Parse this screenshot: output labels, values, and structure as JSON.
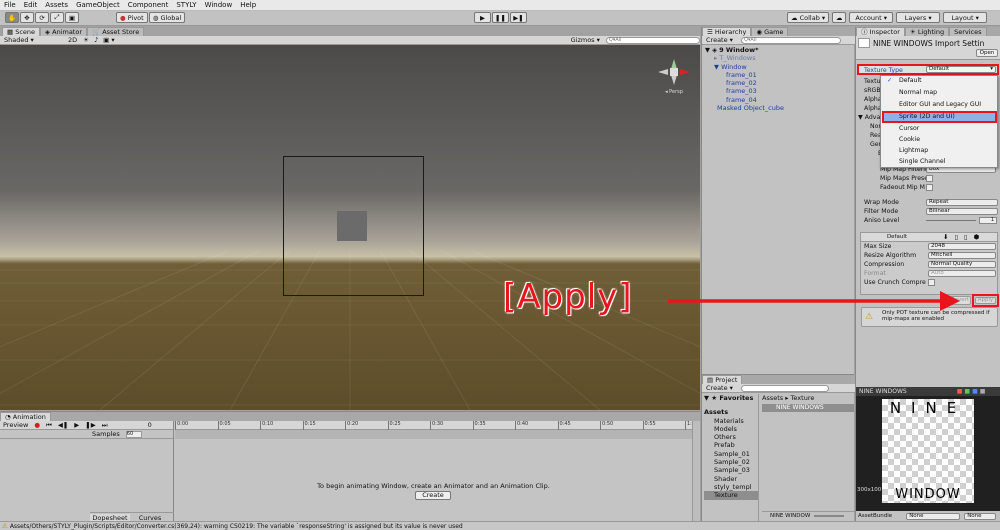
{
  "menu": [
    "File",
    "Edit",
    "Assets",
    "GameObject",
    "Component",
    "STYLY",
    "Window",
    "Help"
  ],
  "toolbar": {
    "pivot": "Pivot",
    "global": "Global",
    "collab": "Collab",
    "account": "Account",
    "layers": "Layers",
    "layout": "Layout"
  },
  "scene": {
    "tabs": [
      "Scene",
      "Animator",
      "Asset Store"
    ],
    "shading": "Shaded",
    "mode_2d": "2D",
    "gizmos": "Gizmos",
    "search": "Q▾All",
    "persp": "◂ Persp"
  },
  "annotation": {
    "label": "[Apply]",
    "color": "#e8151c"
  },
  "hierarchy": {
    "tabs": [
      "Hierarchy",
      "Game"
    ],
    "create": "Create",
    "search": "Q▾All",
    "items": [
      "9 Window*",
      "T_Windows",
      "Window",
      "frame_01",
      "frame_02",
      "frame_03",
      "frame_04",
      "Masked Object_cube"
    ]
  },
  "project": {
    "tab": "Project",
    "create": "Create",
    "favorites": "Favorites",
    "breadcrumb": "Assets ▸ Texture",
    "asset": "NINE WINDOWS",
    "tree": [
      "Assets",
      "Materials",
      "Models",
      "Others",
      "Prefab",
      "Sample_01",
      "Sample_02",
      "Sample_03",
      "Shader",
      "styly_templ",
      "Texture"
    ],
    "footer": "NINE WINDOW"
  },
  "inspector": {
    "tabs": [
      "Inspector",
      "Lighting",
      "Services"
    ],
    "title": "NINE WINDOWS Import Settin",
    "open": "Open",
    "texture_type_label": "Texture Type",
    "texture_type_value": "Default",
    "options": [
      "Default",
      "Normal map",
      "Editor GUI and Legacy GUI",
      "Sprite (2D and UI)",
      "Cursor",
      "Cookie",
      "Lightmap",
      "Single Channel"
    ],
    "left_labels": [
      "Textur",
      "sRGB",
      "Alpha",
      "Alpha",
      "Advan",
      "Nor",
      "Rea",
      "Gen",
      "B"
    ],
    "mip_filter": "Mip Map Filterin",
    "mip_filter_val": "Box",
    "mip_preserve": "Mip Maps Prese",
    "fadeout": "Fadeout Mip M",
    "wrap_label": "Wrap Mode",
    "wrap_val": "Repeat",
    "filter_label": "Filter Mode",
    "filter_val": "Bilinear",
    "aniso_label": "Aniso Level",
    "aniso_val": "1",
    "platform_default": "Default",
    "max_size_label": "Max Size",
    "max_size_val": "2048",
    "resize_label": "Resize Algorithm",
    "resize_val": "Mitchell",
    "compression_label": "Compression",
    "compression_val": "Normal Quality",
    "format_label": "Format",
    "format_val": "Auto",
    "crunch_label": "Use Crunch Compre",
    "apply": "Apply",
    "revert": "Revert",
    "warning": "Only POT texture can be compressed if mip-maps are enabled",
    "preview_title": "NINE WINDOWS",
    "preview_text_top": "NINE",
    "preview_text_bottom": "WINDOW",
    "preview_size": "300x100",
    "asset_bundle": "AssetBundle",
    "ab_none": "None",
    "ab_none2": "None"
  },
  "animation": {
    "tab": "Animation",
    "preview": "Preview",
    "samples_label": "Samples",
    "samples_val": "60",
    "message": "To begin animating Window, create an Animator and an Animation Clip.",
    "create": "Create",
    "dopesheet": "Dopesheet",
    "curves": "Curves",
    "ticks": [
      "0:00",
      "0:05",
      "0:10",
      "0:15",
      "0:20",
      "0:25",
      "0:30",
      "0:35",
      "0:40",
      "0:45",
      "0:50",
      "0:55",
      "1:00"
    ]
  },
  "status": "Assets/Others/STYLY_Plugin/Scripts/Editor/Converter.cs(369,24): warning CS0219: The variable `responseString' is assigned but its value is never used"
}
